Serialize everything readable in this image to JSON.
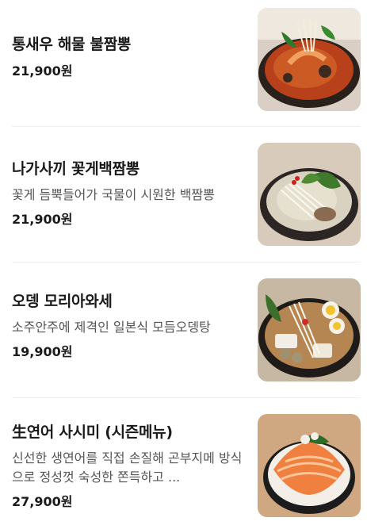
{
  "menu": {
    "items": [
      {
        "name": "통새우 해물 불짬뽕",
        "description": "",
        "price": "21,900원",
        "image_icon": "spicy-seafood-jjamppong-photo"
      },
      {
        "name": "나가사끼 꽃게백짬뽕",
        "description": "꽃게 듬뿍들어가 국물이 시원한 백짬뽕",
        "price": "21,900원",
        "image_icon": "white-crab-jjamppong-photo"
      },
      {
        "name": "오뎅 모리아와세",
        "description": "소주안주에 제격인 일본식 모듬오뎅탕",
        "price": "19,900원",
        "image_icon": "oden-hotpot-photo"
      },
      {
        "name": "生연어 사시미 (시즌메뉴)",
        "description": "신선한 생연어를 직접 손질해 곤부지메 방식으로 정성껏 숙성한 쫀득하고 ...",
        "price": "27,900원",
        "image_icon": "salmon-sashimi-photo"
      }
    ]
  }
}
